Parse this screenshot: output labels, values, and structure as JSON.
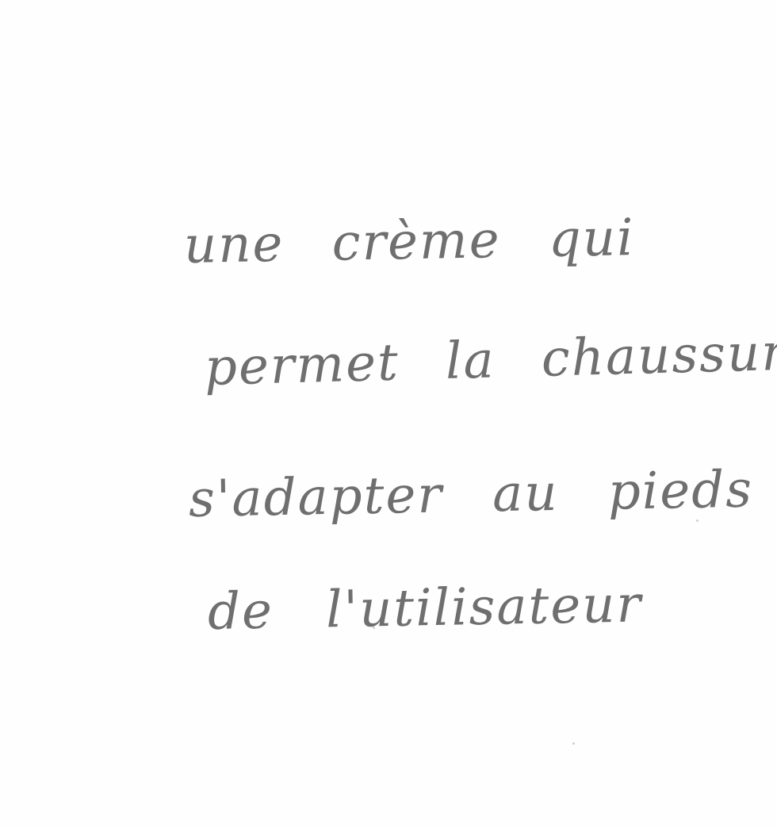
{
  "note": {
    "lines": [
      "une crème qui",
      "permet la chaussure",
      "s'adapter au pieds",
      "de l'utilisateur"
    ]
  },
  "colors": {
    "paper": "#fefefe",
    "pencil": "#6f6f6f"
  }
}
